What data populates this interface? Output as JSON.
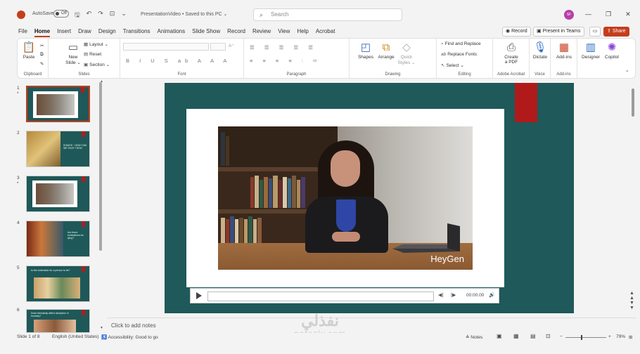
{
  "titlebar": {
    "autosave_label": "AutoSave",
    "autosave_state": "Off",
    "document_title": "PresentationVideo • Saved to this PC ⌄",
    "search_placeholder": "Search",
    "avatar_initials": "SF"
  },
  "tabs": [
    "File",
    "Home",
    "Insert",
    "Draw",
    "Design",
    "Transitions",
    "Animations",
    "Slide Show",
    "Record",
    "Review",
    "View",
    "Help",
    "Acrobat"
  ],
  "active_tab": "Home",
  "top_buttons": {
    "record": "Record",
    "present_teams": "Present in Teams",
    "share": "Share"
  },
  "ribbon": {
    "clipboard": {
      "label": "Clipboard",
      "paste": "Paste"
    },
    "slides": {
      "label": "Slides",
      "new_slide": "New",
      "new_slide_2": "Slide ⌄",
      "layout": "Layout ⌄",
      "reset": "Reset",
      "section": "Section ⌄"
    },
    "font": {
      "label": "Font"
    },
    "paragraph": {
      "label": "Paragraph"
    },
    "drawing": {
      "label": "Drawing",
      "shapes": "Shapes",
      "arrange": "Arrange",
      "quick_styles": "Quick",
      "quick_styles_2": "Styles ⌄"
    },
    "editing": {
      "label": "Editing",
      "find": "Find and Replace",
      "replace": "Replace Fonts",
      "select": "Select ⌄"
    },
    "acrobat": {
      "label": "Adobe Acrobat",
      "create_pdf": "Create",
      "create_pdf_2": "a PDF"
    },
    "voice": {
      "label": "Voice",
      "dictate": "Dictate"
    },
    "addins": {
      "label": "Add-ins",
      "addins": "Add-ins"
    },
    "designer": "Designer",
    "copilot": "Copilot"
  },
  "thumbnails": [
    {
      "number": "1",
      "star": "*"
    },
    {
      "number": "2",
      "text": "SOMOS · HOW CAN WE FACE THEM"
    },
    {
      "number": "3",
      "star": "*"
    },
    {
      "number": "4",
      "text": "Are there motivations for lying?"
    },
    {
      "number": "5",
      "text": "Is the motivation for a person to lie?"
    },
    {
      "number": "6",
      "text": "Does friendship affect deception in honesty?"
    }
  ],
  "slide": {
    "video_logo": "HeyGen",
    "player_time": "00:00.00"
  },
  "notes_placeholder": "Click to add notes",
  "statusbar": {
    "slide_count": "Slide 1 of 8",
    "language": "English (United States)",
    "accessibility": "Accessibility: Good to go",
    "notes": "Notes",
    "zoom": "79%"
  },
  "watermark": {
    "arabic": "نفذلي",
    "latin": "nafezly.com"
  },
  "colors": {
    "accent": "#c43e1c",
    "slide_bg": "#1f5959",
    "slide_red": "#b11a1a"
  }
}
